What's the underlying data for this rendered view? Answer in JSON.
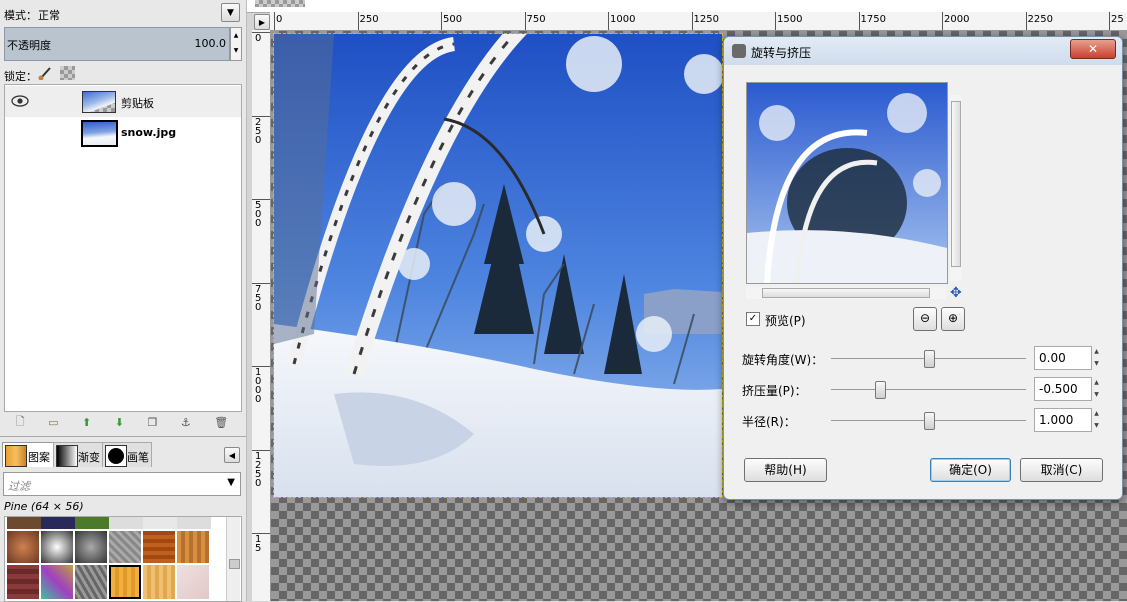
{
  "layers_panel": {
    "mode_label": "模式：",
    "mode_value": "正常",
    "opacity_label": "不透明度",
    "opacity_value": "100.0",
    "lock_label": "锁定：",
    "layers": [
      {
        "name": "剪贴板"
      },
      {
        "name": "snow.jpg"
      }
    ]
  },
  "brushes_panel": {
    "tabs": [
      {
        "label": "图案"
      },
      {
        "label": "渐变"
      },
      {
        "label": "画笔"
      }
    ],
    "filter_placeholder": "过滤",
    "selected_pattern": "Pine (64 × 56)"
  },
  "ruler": {
    "top_ticks": [
      "0",
      "250",
      "500",
      "750",
      "1000",
      "1250",
      "1500",
      "1750",
      "2000",
      "2250",
      "25"
    ],
    "left_ticks": [
      "0",
      "250",
      "500",
      "750",
      "1000",
      "1250",
      "15"
    ]
  },
  "dialog": {
    "title": "旋转与挤压",
    "preview_label": "预览(P)",
    "params": [
      {
        "label": "旋转角度(W)：",
        "value": "0.00",
        "level": 0.5
      },
      {
        "label": "挤压量(P)：",
        "value": "-0.500",
        "level": 0.25
      },
      {
        "label": "半径(R)：",
        "value": "1.000",
        "level": 0.5
      }
    ],
    "help_button": "帮助(H)",
    "ok_button": "确定(O)",
    "cancel_button": "取消(C)"
  },
  "colors": {
    "selection_bg": "#b9c4cf",
    "dialog_title_bg": "#cfdcec"
  }
}
